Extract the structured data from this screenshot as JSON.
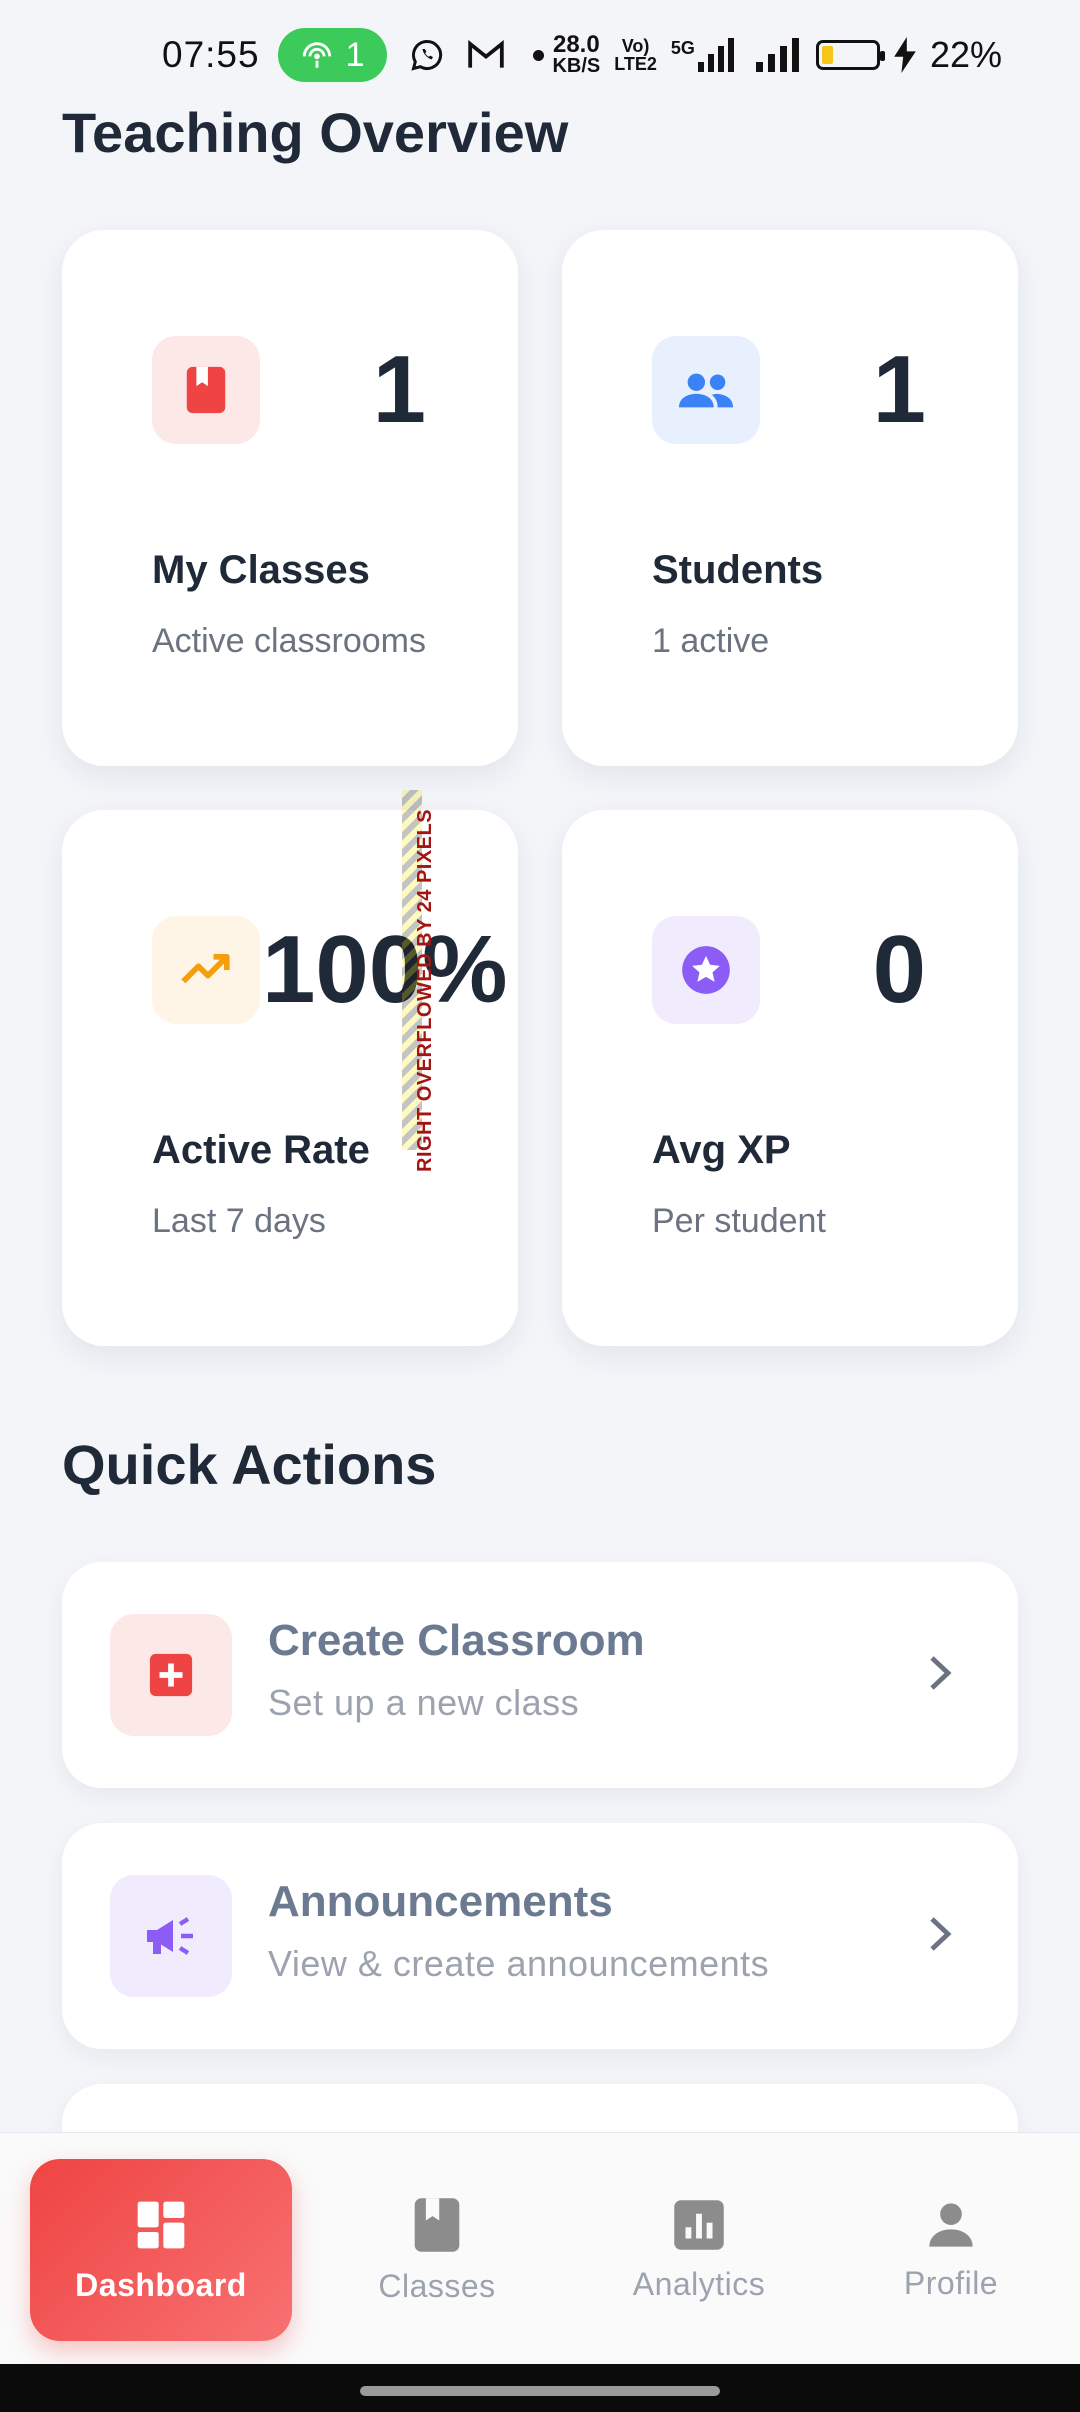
{
  "status_bar": {
    "time": "07:55",
    "hotspot_count": "1",
    "net_speed_value": "28.0",
    "net_speed_unit": "KB/S",
    "volte_top": "Vo)",
    "volte_bottom": "LTE2",
    "network_type": "5G",
    "battery_percent": "22%",
    "battery_level": 0.22
  },
  "overview": {
    "title": "Teaching Overview",
    "cards": [
      {
        "value": "1",
        "label": "My Classes",
        "sub": "Active classrooms",
        "icon": "book-icon",
        "icon_color": "#ef4444",
        "icon_bg": "#fde8e8"
      },
      {
        "value": "1",
        "label": "Students",
        "sub": "1 active",
        "icon": "people-icon",
        "icon_color": "#3b82f6",
        "icon_bg": "#e8f0fe"
      },
      {
        "value": "100%",
        "label": "Active Rate",
        "sub": "Last 7 days",
        "icon": "trending-up-icon",
        "icon_color": "#f59e0b",
        "icon_bg": "#fef5e6"
      },
      {
        "value": "0",
        "label": "Avg XP",
        "sub": "Per student",
        "icon": "star-badge-icon",
        "icon_color": "#8b5cf6",
        "icon_bg": "#f1ecfd"
      }
    ],
    "overflow_warning": "RIGHT OVERFLOWED BY 24 PIXELS"
  },
  "quick_actions": {
    "title": "Quick Actions",
    "items": [
      {
        "title": "Create Classroom",
        "sub": "Set up a new class",
        "icon": "add-box-icon",
        "icon_color": "#ef4444",
        "icon_bg": "#fde8e8"
      },
      {
        "title": "Announcements",
        "sub": "View & create announcements",
        "icon": "megaphone-icon",
        "icon_color": "#8b5cf6",
        "icon_bg": "#f1ecfd"
      }
    ]
  },
  "bottom_nav": {
    "items": [
      {
        "label": "Dashboard",
        "icon": "dashboard-icon",
        "active": true
      },
      {
        "label": "Classes",
        "icon": "classes-book-icon",
        "active": false
      },
      {
        "label": "Analytics",
        "icon": "analytics-icon",
        "active": false
      },
      {
        "label": "Profile",
        "icon": "person-icon",
        "active": false
      }
    ]
  },
  "colors": {
    "accent": "#ef4444",
    "background": "#f3f5f9",
    "text_primary": "#1f2937",
    "text_secondary": "#6b7280"
  }
}
